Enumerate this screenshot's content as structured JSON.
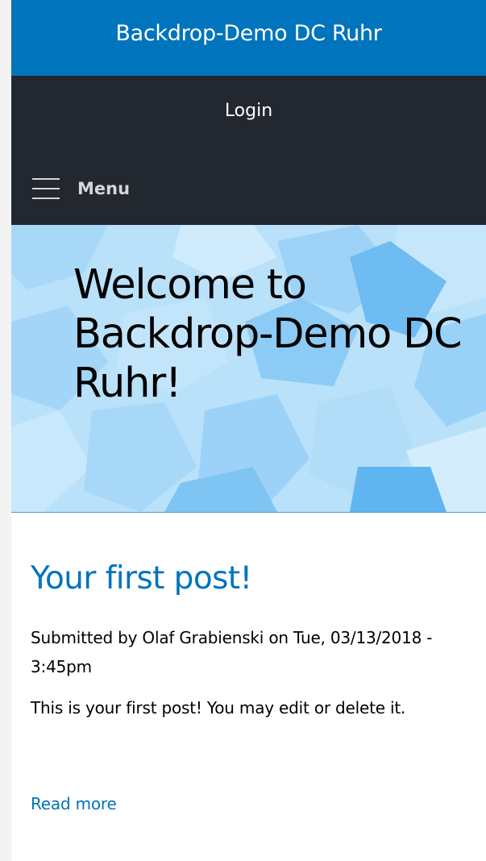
{
  "header": {
    "site_name": "Backdrop-Demo DC Ruhr"
  },
  "account": {
    "login_label": "Login"
  },
  "navigation": {
    "menu_label": "Menu",
    "menu_icon": "hamburger-icon"
  },
  "hero": {
    "title": "Welcome to Backdrop-Demo DC Ruhr!"
  },
  "post": {
    "title": "Your first post!",
    "meta": "Submitted by Olaf Grabienski on Tue, 03/13/2018 - 3:45pm",
    "body": "This is your first post! You may edit or delete it.",
    "read_more": "Read more"
  },
  "colors": {
    "brand_blue": "#0074bd",
    "nav_dark": "#222730",
    "hero_light_blue": "#b7e0fa"
  }
}
